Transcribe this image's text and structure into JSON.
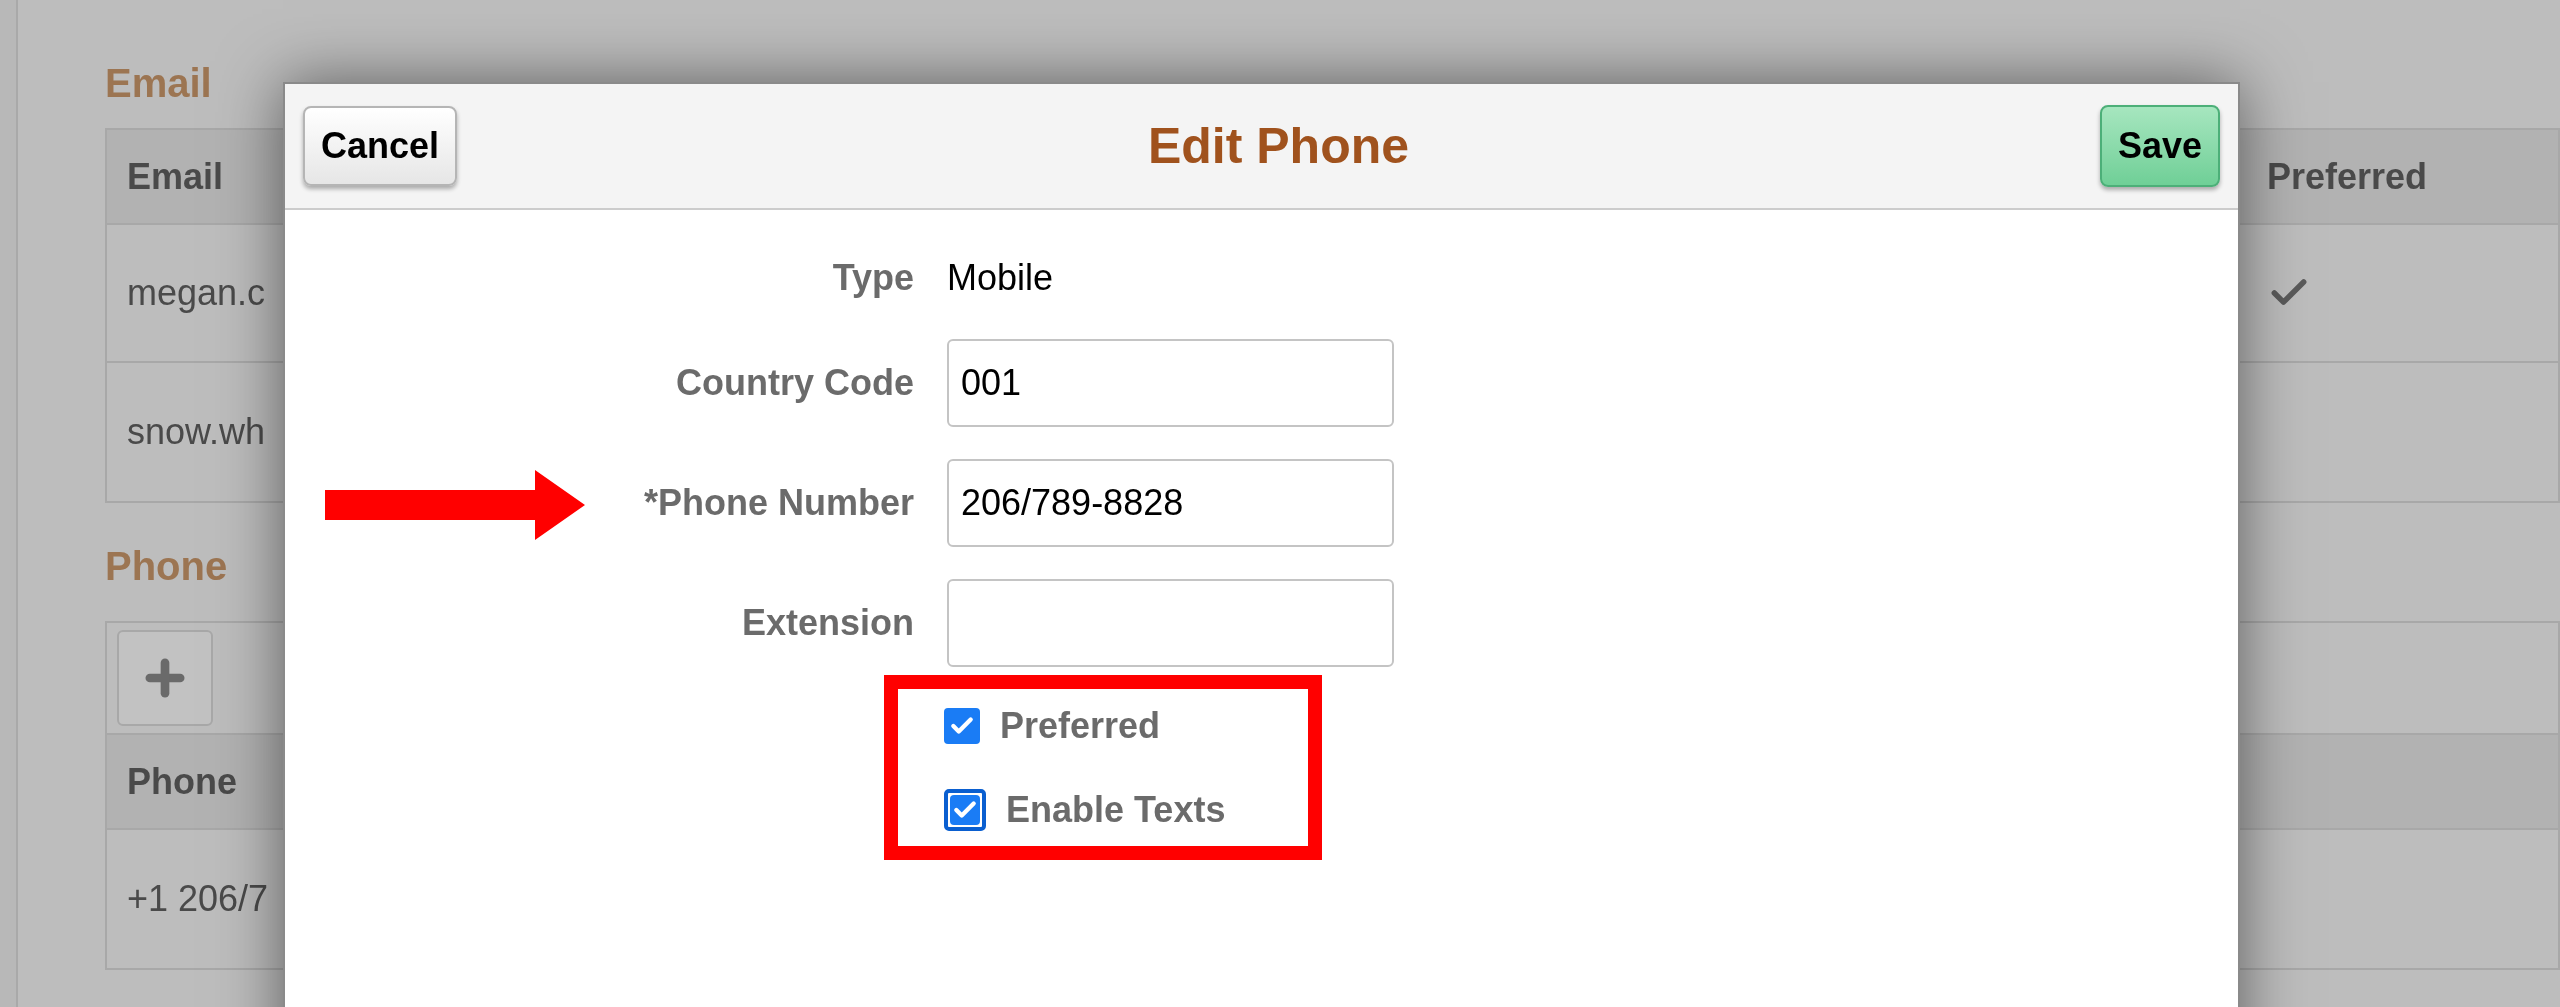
{
  "background": {
    "email_section": {
      "heading": "Email",
      "columns": [
        "Email",
        "Preferred"
      ],
      "rows": [
        {
          "email": "megan.c",
          "preferred": true
        },
        {
          "email": "snow.wh",
          "preferred": false
        }
      ]
    },
    "phone_section": {
      "heading": "Phone",
      "columns": [
        "Phone"
      ],
      "rows": [
        {
          "phone": "+1 206/7"
        }
      ]
    }
  },
  "dialog": {
    "cancel": "Cancel",
    "title": "Edit Phone",
    "save": "Save",
    "fields": [
      {
        "kind": "static",
        "label": "Type",
        "value": "Mobile",
        "annotated": false
      },
      {
        "kind": "input",
        "label": "Country Code",
        "value": "001",
        "annotated": false
      },
      {
        "kind": "input",
        "label": "*Phone Number",
        "value": "206/789-8828",
        "annotated": true
      },
      {
        "kind": "input",
        "label": "Extension",
        "annotated": false
      }
    ],
    "checkboxes": [
      {
        "label": "Preferred",
        "checked": true,
        "focused": false
      },
      {
        "label": "Enable Texts",
        "checked": true,
        "focused": true
      }
    ]
  }
}
